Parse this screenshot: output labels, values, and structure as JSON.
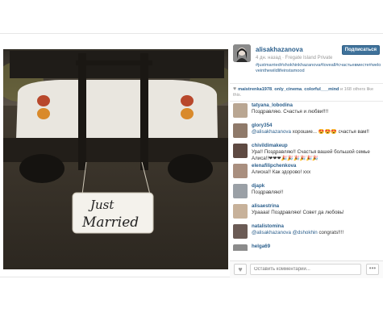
{
  "post": {
    "username": "alisakhazanova",
    "follow_label": "Подписаться",
    "meta": "4 дн. назад · Fregate Island Private",
    "hashtags": "#justmarried#shokhinkhazanova#loveall#счастьевместе#weloveinthewildlifeinstamood",
    "likes": {
      "users": [
        "maistrenka1978",
        "only_cinema",
        "colorful___mind"
      ],
      "tail": "и 168 others like this."
    },
    "comment_placeholder": "Оставить комментарий...",
    "more_label": "•••"
  },
  "comments": [
    {
      "user": "tatyana_lobodina",
      "text": "Поздравляю. Счастья и любви!!!!",
      "mention": ""
    },
    {
      "user": "glory354",
      "mention": "@alisakhazanova",
      "text": " хорошие... 😍😍😍 счастья вам!!"
    },
    {
      "user": "chivildimakeup",
      "text": "Ура!! Поздравляю!! Счастья вашей большой семье Алиса!!❤❤❤🎉🎉🎉🎉🎉🎉",
      "mention": ""
    },
    {
      "user": "elenafilipchenkova",
      "text": "Алиска!! Как здорово! ххх",
      "mention": ""
    },
    {
      "user": "djapk",
      "text": "Поздравляю!!",
      "mention": ""
    },
    {
      "user": "alisaestrina",
      "text": "Ураааа! Поздравляю! Совет да любовь!",
      "mention": ""
    },
    {
      "user": "natalistomina",
      "mention": "@alisakhazanova @dshokhin",
      "text": " congrats!!!!"
    },
    {
      "user": "helga69",
      "text": "",
      "mention": ""
    }
  ],
  "sign": {
    "line1": "Just",
    "line2": "Married"
  },
  "colors": {
    "link": "#2b5f8c",
    "button": "#3f729b",
    "muted": "#999999"
  },
  "icons": {
    "like": "heart-icon",
    "more": "ellipsis-icon"
  }
}
